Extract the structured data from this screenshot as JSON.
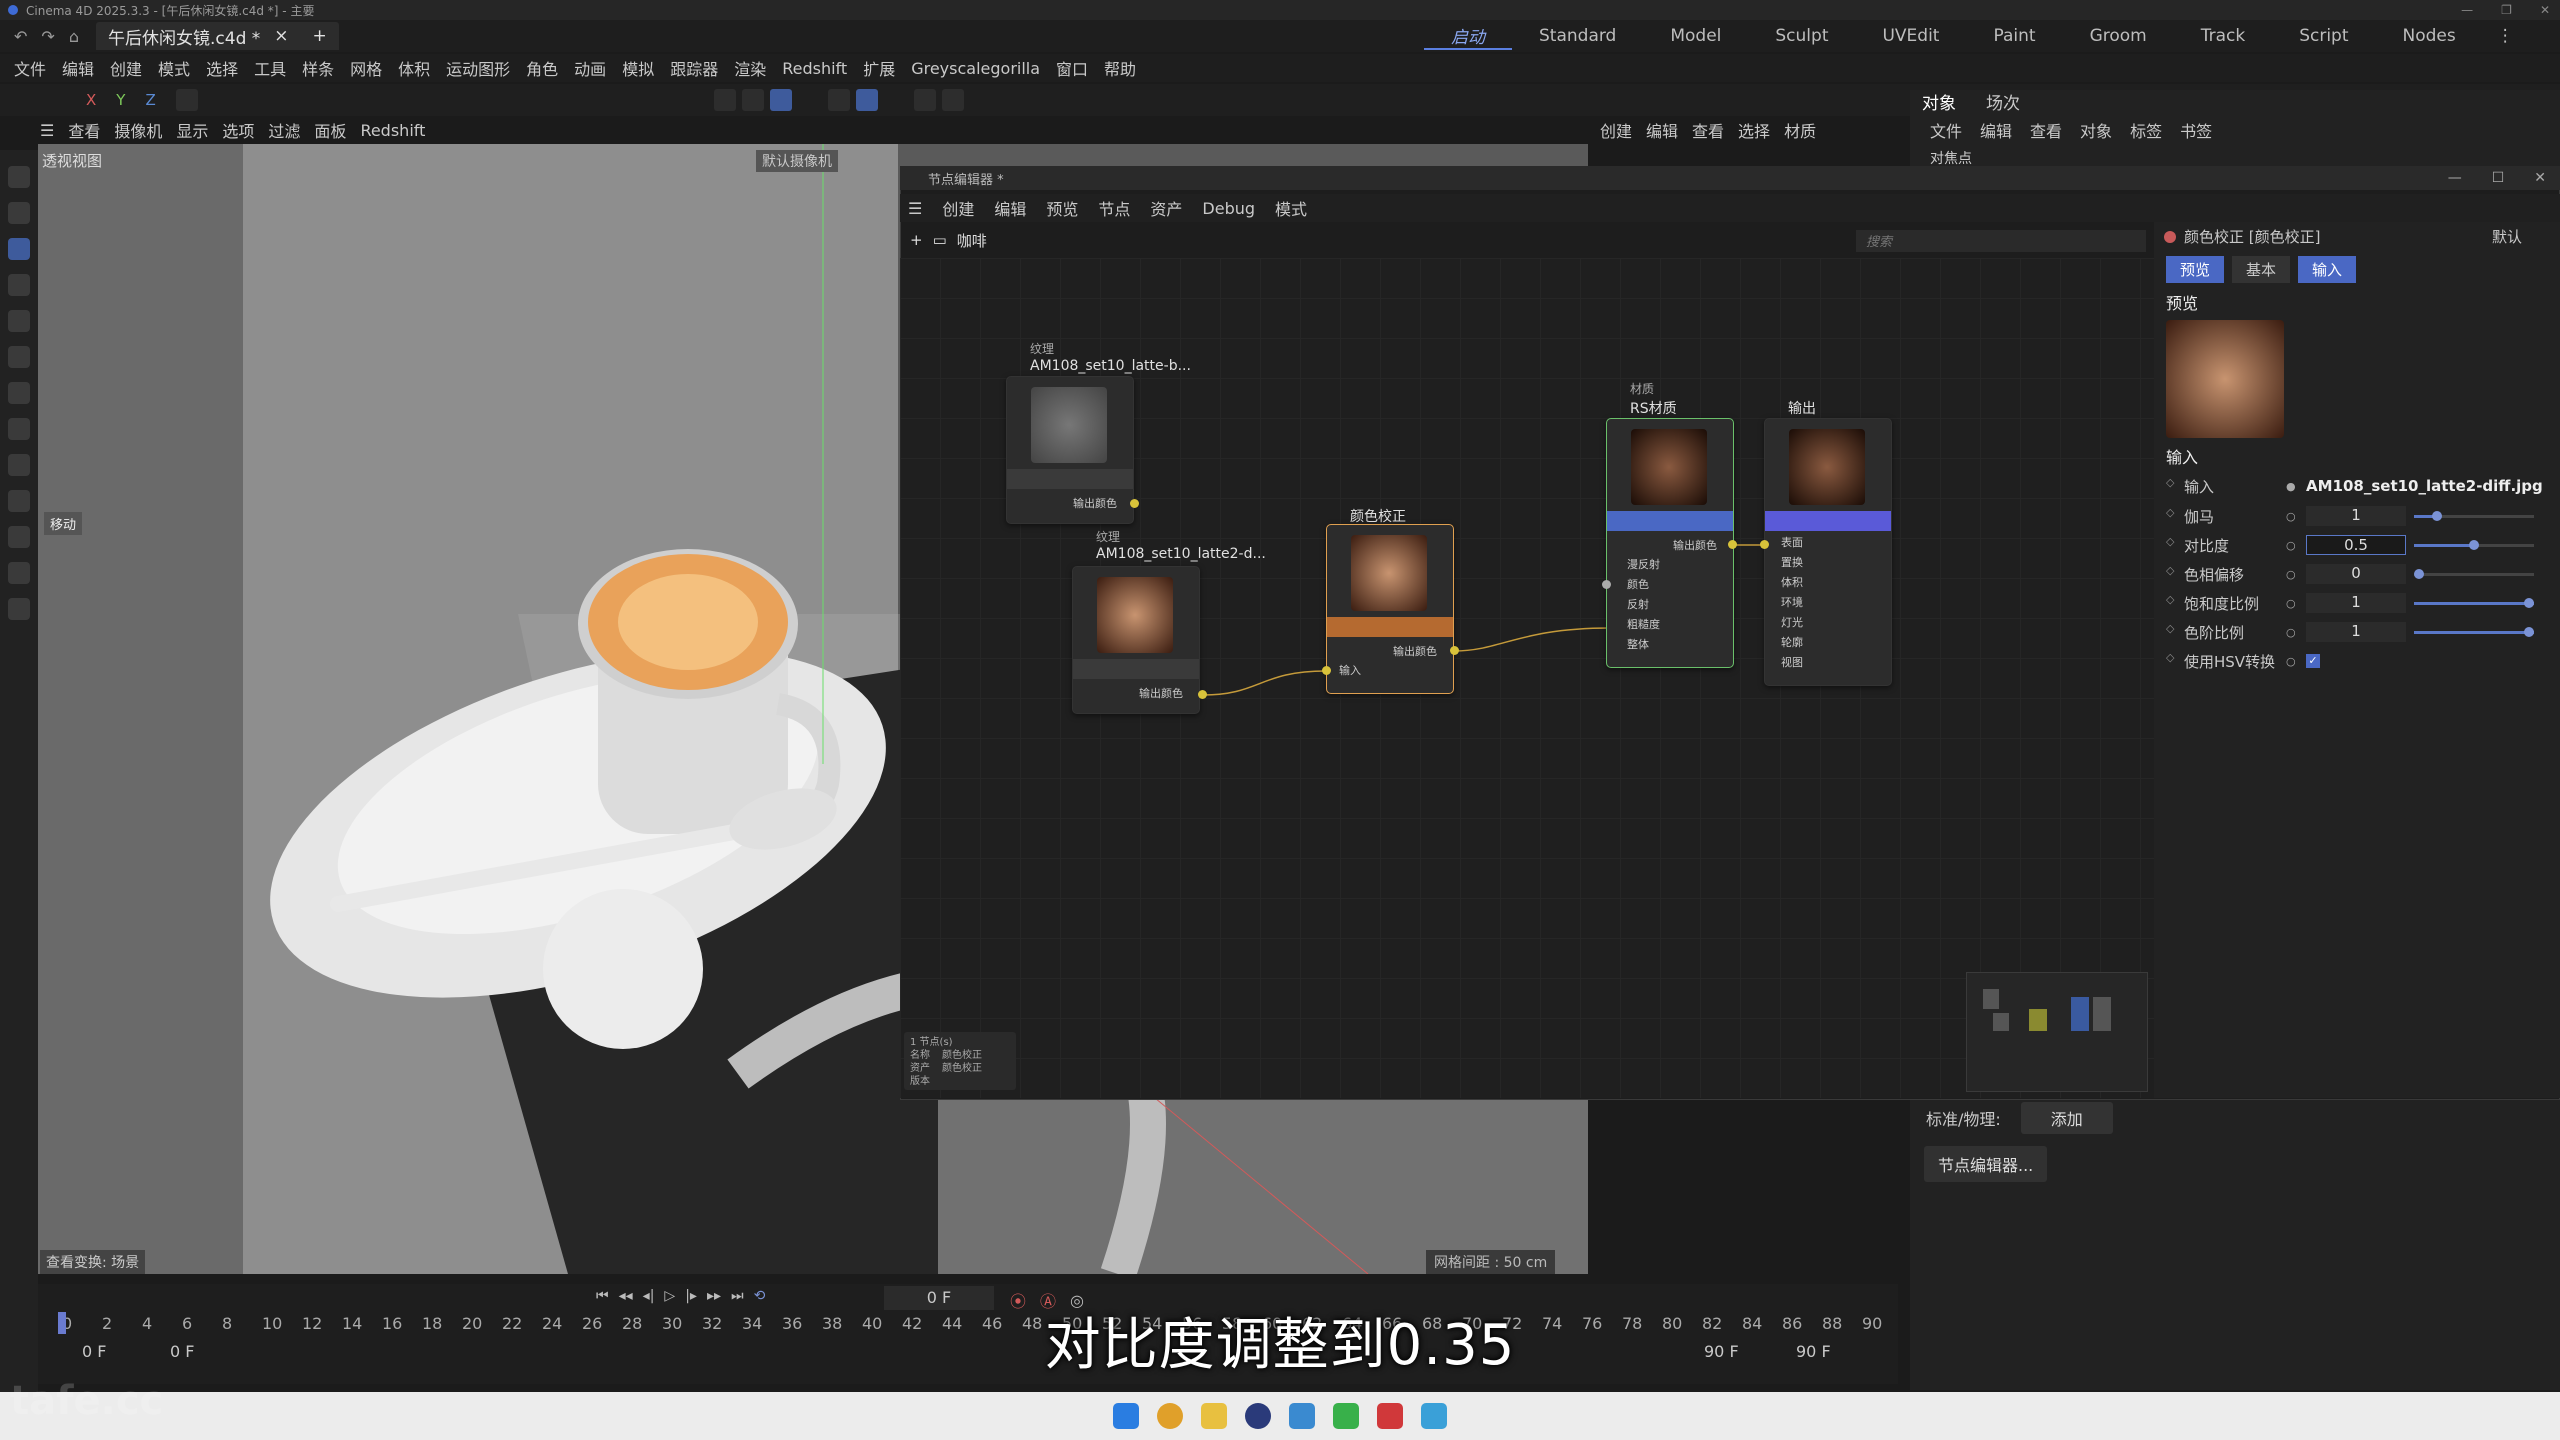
{
  "titlebar": {
    "text": "Cinema 4D 2025.3.3 - [午后休闲女镜.c4d *] - 主要"
  },
  "doc_tab": {
    "label": "午后休闲女镜.c4d *",
    "close": "×",
    "add": "+"
  },
  "layouts": [
    "启动",
    "Standard",
    "Model",
    "Sculpt",
    "UVEdit",
    "Paint",
    "Groom",
    "Track",
    "Script",
    "Nodes"
  ],
  "menubar": [
    "文件",
    "编辑",
    "创建",
    "模式",
    "选择",
    "工具",
    "样条",
    "网格",
    "体积",
    "运动图形",
    "角色",
    "动画",
    "模拟",
    "跟踪器",
    "渲染",
    "Redshift",
    "扩展",
    "Greyscalegorilla",
    "窗口",
    "帮助"
  ],
  "axis": {
    "x": "X",
    "y": "Y",
    "z": "Z"
  },
  "viewport_menu": [
    "查看",
    "摄像机",
    "显示",
    "选项",
    "过滤",
    "面板",
    "Redshift"
  ],
  "viewport": {
    "label": "透视视图",
    "camera": "默认摄像机",
    "move_label": "移动",
    "status": "查看变换: 场景",
    "grid": "网格间距 : 50 cm"
  },
  "right_panel": {
    "tabs": [
      "对象",
      "场次"
    ],
    "menu": [
      "文件",
      "编辑",
      "查看",
      "对象",
      "标签",
      "书签"
    ],
    "tree_item": "对焦点",
    "std_label": "标准/物理:",
    "add_button": "添加",
    "node_editor_button": "节点编辑器..."
  },
  "viewport_top_menu": [
    "创建",
    "编辑",
    "查看",
    "选择",
    "材质"
  ],
  "node_editor": {
    "title": "节点编辑器 *",
    "menu": [
      "创建",
      "编辑",
      "预览",
      "节点",
      "资产",
      "Debug",
      "模式"
    ],
    "path": "咖啡",
    "search_placeholder": "搜索",
    "nodes": {
      "tex1": {
        "category": "纹理",
        "name": "AM108_set10_latte-b...",
        "output": "输出颜色"
      },
      "tex2": {
        "category": "纹理",
        "name": "AM108_set10_latte2-d...",
        "output": "输出颜色"
      },
      "cc": {
        "name": "颜色校正",
        "output": "输出颜色",
        "input": "输入"
      },
      "rs": {
        "category": "材质",
        "name": "RS材质",
        "output": "输出颜色",
        "ports": [
          "漫反射",
          "颜色",
          "反射",
          "粗糙度",
          "整体"
        ]
      },
      "out": {
        "name": "输出",
        "ports": [
          "表面",
          "置换",
          "体积",
          "环境",
          "灯光",
          "轮廓",
          "视图"
        ]
      }
    },
    "selection_info": {
      "count": "1 节点(s)",
      "name_label": "名称",
      "name_value": "颜色校正",
      "asset_label": "资产",
      "asset_value": "颜色校正",
      "version_label": "版本",
      "version_value": ""
    }
  },
  "attributes": {
    "header": "颜色校正 [颜色校正]",
    "preset": "默认",
    "tabs": [
      "预览",
      "基本",
      "输入"
    ],
    "preview_label": "预览",
    "input_section": "输入",
    "rows": [
      {
        "name": "输入",
        "value": "AM108_set10_latte2-diff.jpg"
      },
      {
        "name": "伽马",
        "value": "1",
        "level": 0.16
      },
      {
        "name": "对比度",
        "value": "0.5",
        "level": 0.5
      },
      {
        "name": "色相偏移",
        "value": "0",
        "level": 0.0
      },
      {
        "name": "饱和度比例",
        "value": "1",
        "level": 1.0
      },
      {
        "name": "色阶比例",
        "value": "1",
        "level": 1.0
      },
      {
        "name": "使用HSV转换",
        "value": "✓"
      }
    ]
  },
  "timeline": {
    "frame": "0 F",
    "start": "0 F",
    "start2": "0 F",
    "end": "90 F",
    "end2": "90 F",
    "ticks": [
      "0",
      "2",
      "4",
      "6",
      "8",
      "10",
      "12",
      "14",
      "16",
      "18",
      "20",
      "22",
      "24",
      "26",
      "28",
      "30",
      "32",
      "34",
      "36",
      "38",
      "40",
      "42",
      "44",
      "46",
      "48",
      "50",
      "52",
      "54",
      "56",
      "58",
      "60",
      "62",
      "64",
      "66",
      "68",
      "70",
      "72",
      "74",
      "76",
      "78",
      "80",
      "82",
      "84",
      "86",
      "88",
      "90"
    ]
  },
  "subtitle": "对比度调整到0.35",
  "watermark": "tafe.cc",
  "colors": {
    "accent": "#5b7fe0",
    "node_header": "#4a68c4",
    "cc_header": "#b56a30",
    "port": "#d8c23a",
    "wire": "#c49a3a"
  }
}
